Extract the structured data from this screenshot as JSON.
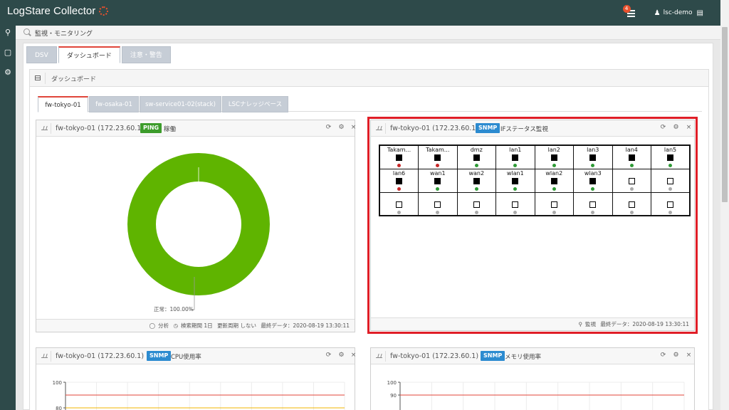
{
  "app": {
    "title": "LogStare Collector"
  },
  "topbar": {
    "notification_count": "4",
    "user_name": "lsc-demo"
  },
  "sidebar": {
    "items": [
      {
        "icon": "search-icon"
      },
      {
        "icon": "book-icon"
      },
      {
        "icon": "gears-icon"
      }
    ]
  },
  "breadcrumb": {
    "text": "監視・モニタリング"
  },
  "main_tabs": [
    {
      "label": "DSV"
    },
    {
      "label": "ダッシュボード"
    },
    {
      "label": "注意・警告"
    }
  ],
  "dashboard": {
    "title": "ダッシュボード",
    "tabs": [
      {
        "label": "fw-tokyo-01"
      },
      {
        "label": "fw-osaka-01"
      },
      {
        "label": "sw-service01-02(stack)"
      },
      {
        "label": "LSCナレッジベース"
      }
    ]
  },
  "widgets": {
    "ping": {
      "host": "fw-tokyo-01 (172.23.60.1)",
      "badge": "PING",
      "metric": "稼働",
      "footer": {
        "analysis": "分析",
        "period": "検索期間 1日",
        "refresh": "更新周期 しない",
        "last": "最終データ：2020-08-19 13:30:11"
      }
    },
    "ifstatus": {
      "host": "fw-tokyo-01 (172.23.60.1)",
      "badge": "SNMP",
      "metric": "IFステータス監視",
      "footer": {
        "monitor": "監視",
        "last": "最終データ：2020-08-19 13:30:11"
      }
    },
    "cpu": {
      "host": "fw-tokyo-01 (172.23.60.1)",
      "badge": "SNMP",
      "metric": "CPU使用率"
    },
    "mem": {
      "host": "fw-tokyo-01 (172.23.60.1)",
      "badge": "SNMP",
      "metric": "メモリ使用率"
    }
  },
  "interfaces": [
    [
      {
        "name": "Takam...",
        "state": "filled",
        "status": "red"
      },
      {
        "name": "Takam...",
        "state": "filled",
        "status": "red"
      },
      {
        "name": "dmz",
        "state": "filled",
        "status": "green"
      },
      {
        "name": "lan1",
        "state": "filled",
        "status": "green"
      },
      {
        "name": "lan2",
        "state": "filled",
        "status": "green"
      },
      {
        "name": "lan3",
        "state": "filled",
        "status": "green"
      },
      {
        "name": "lan4",
        "state": "filled",
        "status": "green"
      },
      {
        "name": "lan5",
        "state": "filled",
        "status": "green"
      }
    ],
    [
      {
        "name": "lan6",
        "state": "filled",
        "status": "red"
      },
      {
        "name": "wan1",
        "state": "filled",
        "status": "green"
      },
      {
        "name": "wan2",
        "state": "filled",
        "status": "green"
      },
      {
        "name": "wlan1",
        "state": "filled",
        "status": "green"
      },
      {
        "name": "wlan2",
        "state": "filled",
        "status": "green"
      },
      {
        "name": "wlan3",
        "state": "filled",
        "status": "green"
      },
      {
        "name": "",
        "state": "empty",
        "status": "gray"
      },
      {
        "name": "",
        "state": "empty",
        "status": "gray"
      }
    ],
    [
      {
        "name": "",
        "state": "empty",
        "status": "gray"
      },
      {
        "name": "",
        "state": "empty",
        "status": "gray"
      },
      {
        "name": "",
        "state": "empty",
        "status": "gray"
      },
      {
        "name": "",
        "state": "empty",
        "status": "gray"
      },
      {
        "name": "",
        "state": "empty",
        "status": "gray"
      },
      {
        "name": "",
        "state": "empty",
        "status": "gray"
      },
      {
        "name": "",
        "state": "empty",
        "status": "gray"
      },
      {
        "name": "",
        "state": "empty",
        "status": "gray"
      }
    ]
  ],
  "colors": {
    "accent": "#e0453a",
    "ping_badge": "#3c9c2b",
    "snmp_badge": "#2c8bd0",
    "topbar": "#2e4a4a",
    "highlight": "#e01e27"
  },
  "chart_data": [
    {
      "type": "pie",
      "categories": [
        "正常"
      ],
      "values": [
        100.0
      ],
      "labels": [
        "正常：100.00%"
      ],
      "colors": [
        "#5fb400"
      ]
    },
    {
      "type": "line",
      "yticks": [
        100,
        80
      ],
      "thresholds": [
        {
          "value": 90,
          "color": "#e0453a"
        },
        {
          "value": 80,
          "color": "#f0b400"
        }
      ]
    },
    {
      "type": "line",
      "yticks": [
        100,
        90
      ],
      "thresholds": [
        {
          "value": 90,
          "color": "#e0453a"
        }
      ]
    }
  ]
}
